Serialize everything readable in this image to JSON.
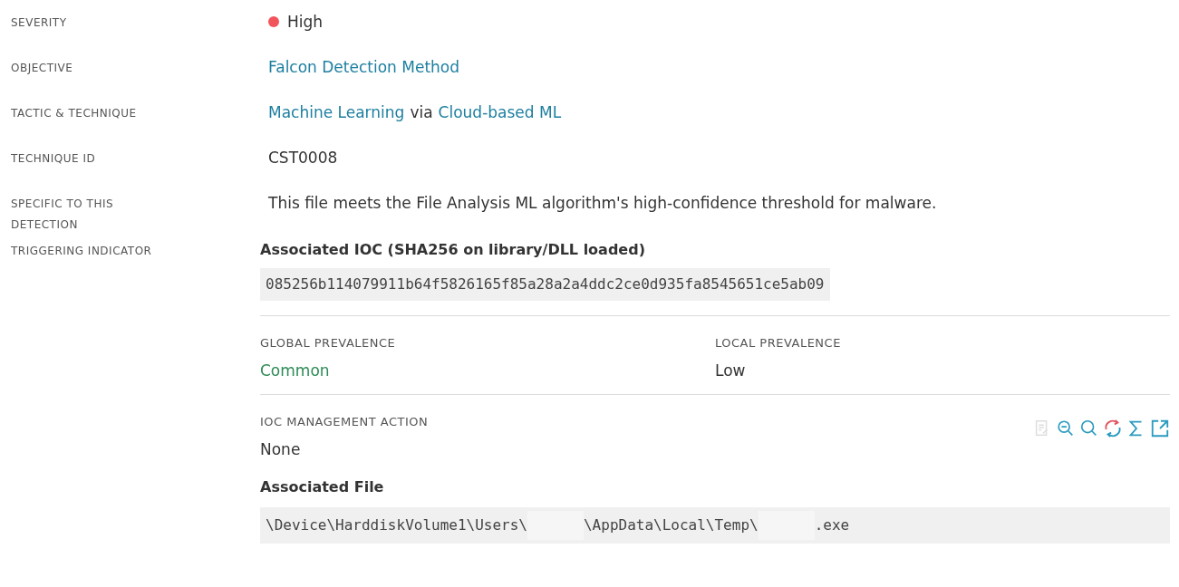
{
  "fields": [
    {
      "label": "SEVERITY",
      "kind": "severity",
      "value": "High",
      "color": "#f2545b"
    },
    {
      "label": "OBJECTIVE",
      "kind": "links",
      "parts": [
        {
          "text": "Falcon Detection Method",
          "link": true
        }
      ]
    },
    {
      "label": "TACTIC & TECHNIQUE",
      "kind": "links",
      "parts": [
        {
          "text": "Machine Learning",
          "link": true
        },
        {
          "text": "via",
          "link": false
        },
        {
          "text": "Cloud-based ML",
          "link": true
        }
      ]
    },
    {
      "label": "TECHNIQUE ID",
      "kind": "text",
      "value": "CST0008"
    },
    {
      "label": "SPECIFIC TO THIS DETECTION",
      "kind": "text",
      "value": "This file meets the File Analysis ML algorithm's high-confidence threshold for malware."
    },
    {
      "label": "TRIGGERING INDICATOR",
      "kind": "indicator"
    }
  ],
  "indicator": {
    "title": "Associated IOC (SHA256 on library/DLL loaded)",
    "hash": "085256b114079911b64f5826165f85a28a2a4ddc2ce0d935fa8545651ce5ab09",
    "prevalence": [
      {
        "label": "GLOBAL PREVALENCE",
        "value": "Common",
        "color": "#2e8b57"
      },
      {
        "label": "LOCAL PREVALENCE",
        "value": "Low",
        "color": "#333333"
      }
    ],
    "action": {
      "label": "IOC MANAGEMENT ACTION",
      "value": "None"
    },
    "tools": [
      {
        "kind": "doc",
        "disabled": true
      },
      {
        "kind": "zoom-out",
        "disabled": false
      },
      {
        "kind": "search",
        "disabled": false
      },
      {
        "kind": "sync",
        "disabled": false
      },
      {
        "kind": "sigma",
        "disabled": false
      },
      {
        "kind": "external",
        "disabled": false
      }
    ],
    "file_title": "Associated File",
    "path": [
      {
        "kind": "text",
        "text": "\\Device\\HarddiskVolume1\\Users\\"
      },
      {
        "kind": "redacted"
      },
      {
        "kind": "text",
        "text": "\\AppData\\Local\\Temp\\"
      },
      {
        "kind": "redacted"
      },
      {
        "kind": "text",
        "text": ".exe"
      }
    ]
  }
}
